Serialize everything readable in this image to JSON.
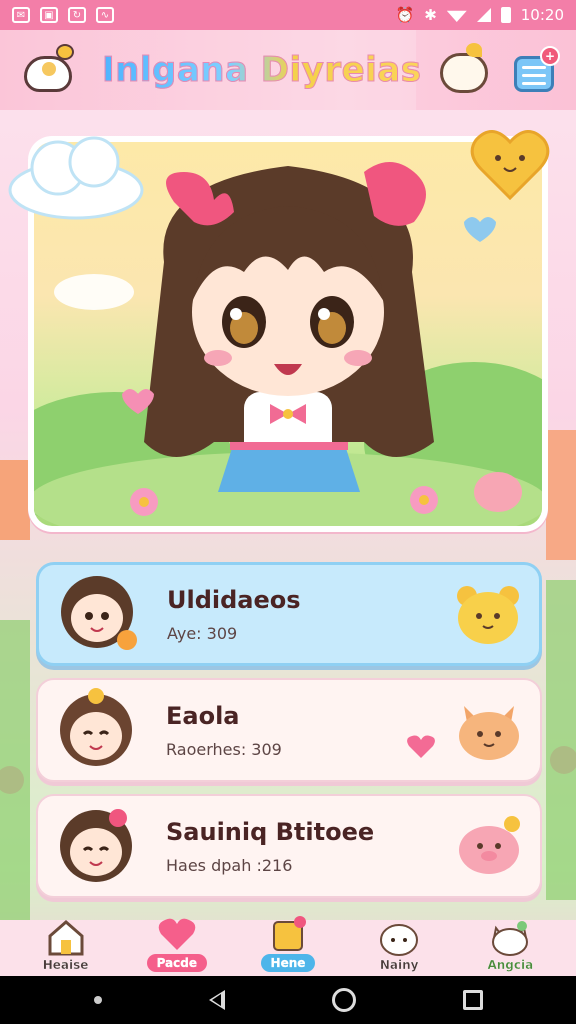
{
  "status_bar": {
    "time": "10:20"
  },
  "header": {
    "title": "Inlgana Diyreias"
  },
  "header_badge": "+",
  "list": [
    {
      "name": "Uldidaeos",
      "sub": "Aye: 309"
    },
    {
      "name": "Eaola",
      "sub": "Raoerhes: 309"
    },
    {
      "name": "Sauiniq Btitoee",
      "sub": "Haes dpah :216"
    }
  ],
  "nav": {
    "items": [
      {
        "label": "Heaise"
      },
      {
        "label": "Pacde"
      },
      {
        "label": "Hene"
      },
      {
        "label": "Nainy"
      },
      {
        "label": "Angcia"
      }
    ]
  },
  "colors": {
    "status_bar": "#f37ea8",
    "active_card": "#c7eafc",
    "card": "#fff4f2",
    "nav_active": "#4db5ea",
    "nav_pink": "#f55f8b"
  }
}
